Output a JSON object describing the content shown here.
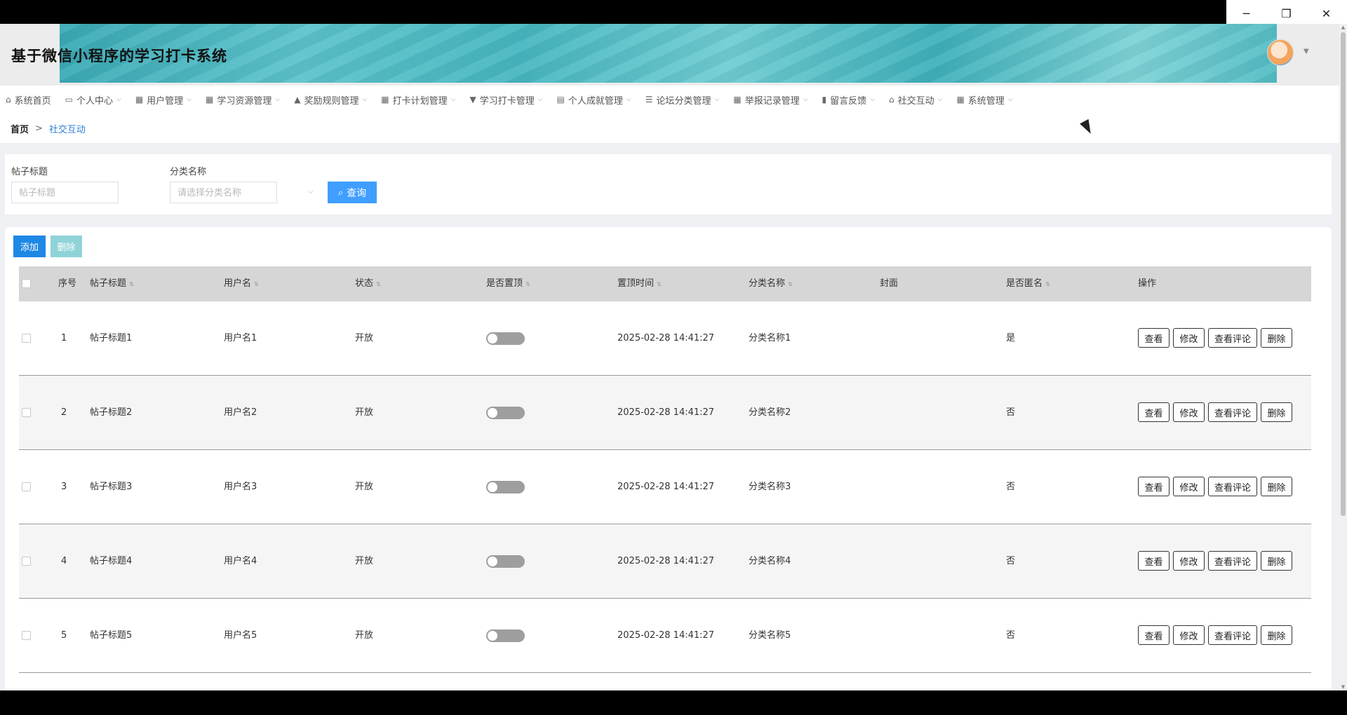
{
  "window": {
    "controls": {
      "minimize": "─",
      "restore": "❐",
      "close": "✕"
    }
  },
  "header": {
    "system_title": "基于微信小程序的学习打卡系统"
  },
  "nav": {
    "items": [
      {
        "label": "系统首页",
        "icon": "home-icon",
        "glyph": "⌂",
        "has_chevron": false
      },
      {
        "label": "个人中心",
        "icon": "card-icon",
        "glyph": "▭",
        "has_chevron": true
      },
      {
        "label": "用户管理",
        "icon": "grid-icon",
        "glyph": "▦",
        "has_chevron": true
      },
      {
        "label": "学习资源管理",
        "icon": "grid-icon",
        "glyph": "▦",
        "has_chevron": true
      },
      {
        "label": "奖励规则管理",
        "icon": "thumb-up-icon",
        "glyph": "▲",
        "has_chevron": true
      },
      {
        "label": "打卡计划管理",
        "icon": "grid-icon",
        "glyph": "▦",
        "has_chevron": true
      },
      {
        "label": "学习打卡管理",
        "icon": "thumb-icon",
        "glyph": "▼",
        "has_chevron": true
      },
      {
        "label": "个人成就管理",
        "icon": "clipboard-icon",
        "glyph": "▤",
        "has_chevron": true
      },
      {
        "label": "论坛分类管理",
        "icon": "menu-icon",
        "glyph": "☰",
        "has_chevron": true
      },
      {
        "label": "举报记录管理",
        "icon": "grid-icon",
        "glyph": "▦",
        "has_chevron": true
      },
      {
        "label": "留言反馈",
        "icon": "bar-chart-icon",
        "glyph": "▮",
        "has_chevron": true
      },
      {
        "label": "社交互动",
        "icon": "shop-icon",
        "glyph": "⌂",
        "has_chevron": true
      },
      {
        "label": "系统管理",
        "icon": "grid-icon",
        "glyph": "▦",
        "has_chevron": true
      }
    ]
  },
  "breadcrumb": {
    "home": "首页",
    "separator": ">",
    "current": "社交互动"
  },
  "search": {
    "title_label": "帖子标题",
    "title_placeholder": "帖子标题",
    "category_label": "分类名称",
    "category_placeholder": "请选择分类名称",
    "query_label": "查询"
  },
  "toolbar": {
    "add_label": "添加",
    "delete_label": "删除"
  },
  "table": {
    "headers": {
      "index": "序号",
      "title": "帖子标题",
      "username": "用户名",
      "status": "状态",
      "pinned": "是否置顶",
      "pinned_time": "置顶时间",
      "category": "分类名称",
      "cover": "封面",
      "anonymous": "是否匿名",
      "actions": "操作"
    },
    "action_labels": {
      "view": "查看",
      "edit": "修改",
      "comments": "查看评论",
      "delete": "删除"
    },
    "rows": [
      {
        "index": "1",
        "title": "帖子标题1",
        "username": "用户名1",
        "status": "开放",
        "pinned": false,
        "pinned_time": "2025-02-28 14:41:27",
        "category": "分类名称1",
        "anonymous": "是"
      },
      {
        "index": "2",
        "title": "帖子标题2",
        "username": "用户名2",
        "status": "开放",
        "pinned": false,
        "pinned_time": "2025-02-28 14:41:27",
        "category": "分类名称2",
        "anonymous": "否"
      },
      {
        "index": "3",
        "title": "帖子标题3",
        "username": "用户名3",
        "status": "开放",
        "pinned": false,
        "pinned_time": "2025-02-28 14:41:27",
        "category": "分类名称3",
        "anonymous": "否"
      },
      {
        "index": "4",
        "title": "帖子标题4",
        "username": "用户名4",
        "status": "开放",
        "pinned": false,
        "pinned_time": "2025-02-28 14:41:27",
        "category": "分类名称4",
        "anonymous": "否"
      },
      {
        "index": "5",
        "title": "帖子标题5",
        "username": "用户名5",
        "status": "开放",
        "pinned": false,
        "pinned_time": "2025-02-28 14:41:27",
        "category": "分类名称5",
        "anonymous": "否"
      }
    ]
  },
  "colors": {
    "primary": "#1e88e5",
    "query": "#409eff",
    "delete_disabled": "#8fd3d8",
    "link": "#2a7ed6",
    "header_row": "#d6d6d6"
  }
}
